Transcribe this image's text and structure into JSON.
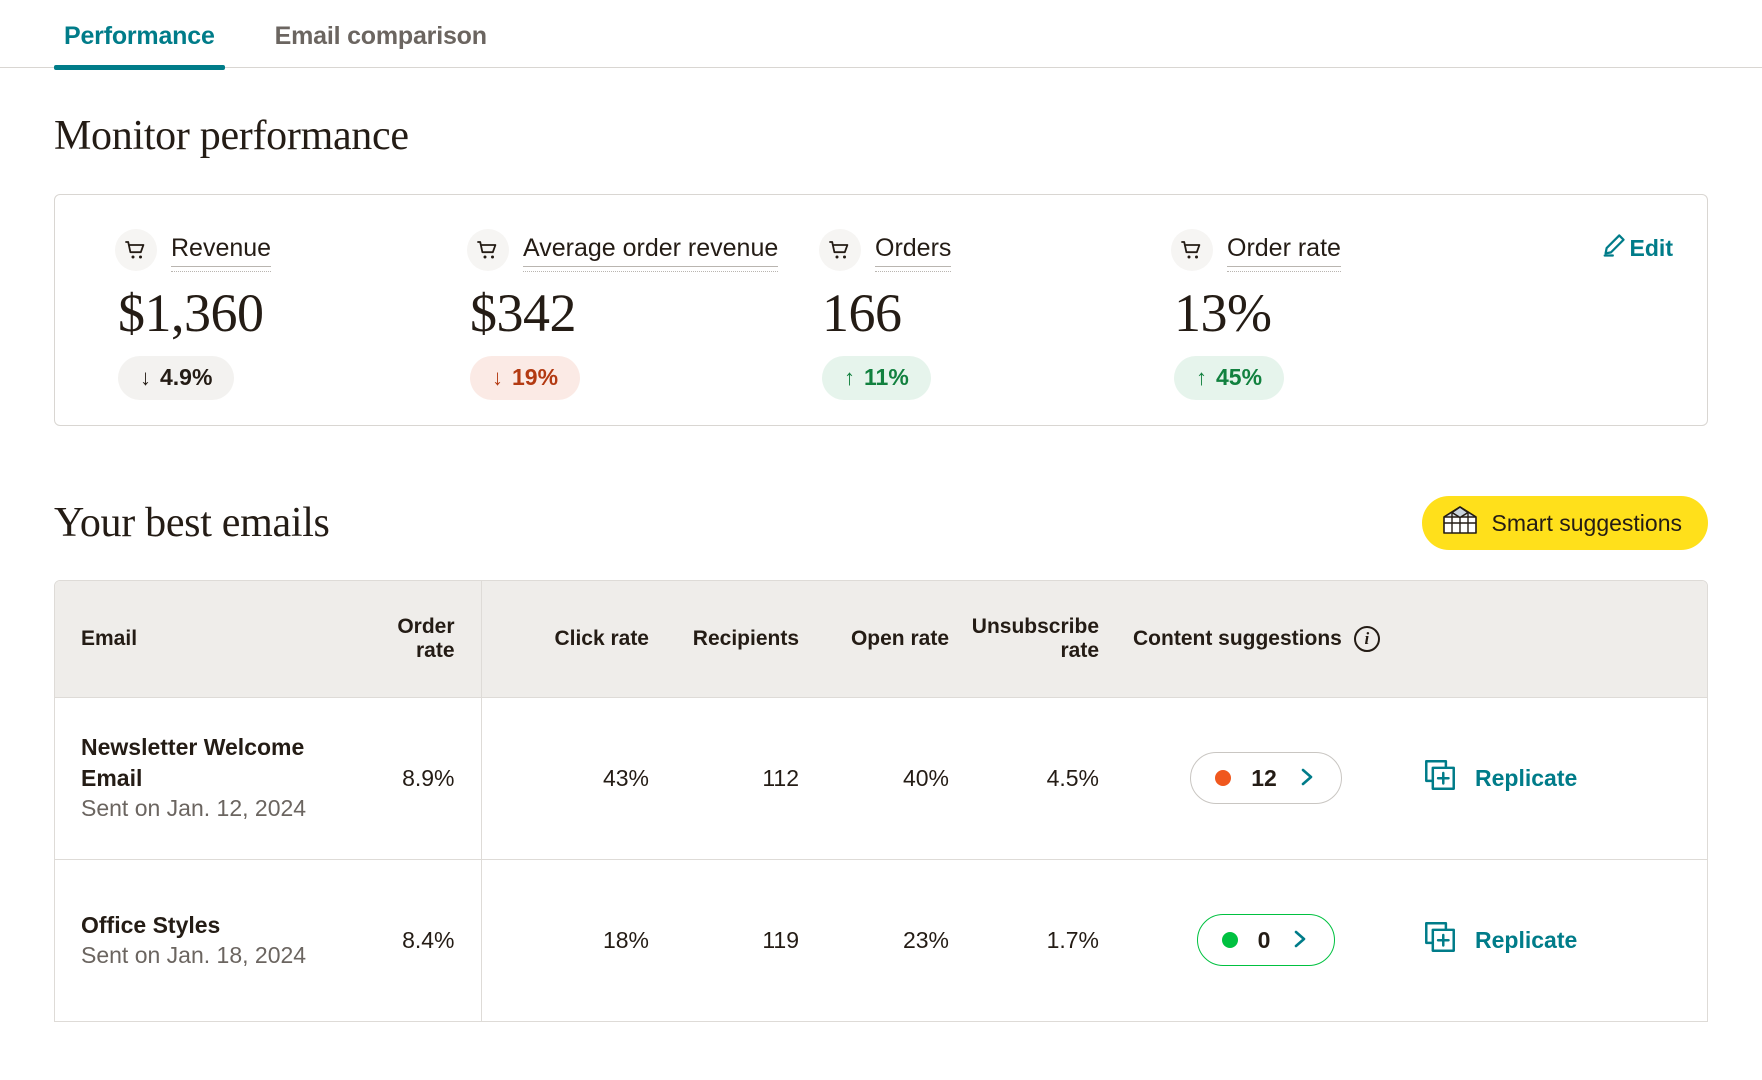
{
  "tabs": [
    {
      "label": "Performance",
      "active": true
    },
    {
      "label": "Email comparison",
      "active": false
    }
  ],
  "monitor": {
    "heading": "Monitor performance",
    "edit_label": "Edit",
    "metrics": [
      {
        "icon": "shopping-cart-icon",
        "label": "Revenue",
        "value": "$1,360",
        "delta": "4.9%",
        "direction": "down",
        "tone": "neutral"
      },
      {
        "icon": "shopping-cart-icon",
        "label": "Average order revenue",
        "value": "$342",
        "delta": "19%",
        "direction": "down",
        "tone": "down"
      },
      {
        "icon": "shopping-cart-icon",
        "label": "Orders",
        "value": "166",
        "delta": "11%",
        "direction": "up",
        "tone": "up"
      },
      {
        "icon": "shopping-cart-icon",
        "label": "Order rate",
        "value": "13%",
        "delta": "45%",
        "direction": "up",
        "tone": "up"
      }
    ]
  },
  "best_emails": {
    "heading": "Your best emails",
    "smart_button": {
      "label": "Smart suggestions",
      "icon": "greenhouse-icon",
      "bg": "#ffe01b"
    },
    "columns": {
      "email": "Email",
      "order_rate": "Order rate",
      "click_rate": "Click rate",
      "recipients": "Recipients",
      "open_rate": "Open rate",
      "unsubscribe_rate": "Unsubscribe rate",
      "content_suggestions": "Content suggestions",
      "info_glyph": "i"
    },
    "rows": [
      {
        "name": "Newsletter Welcome Email",
        "sent": "Sent on Jan. 12, 2024",
        "order_rate": "8.9%",
        "click_rate": "43%",
        "recipients": "112",
        "open_rate": "40%",
        "unsubscribe_rate": "4.5%",
        "suggestions_count": "12",
        "suggestions_tone": "orange",
        "suggestions_dot_color": "#f0581e",
        "replicate_label": "Replicate"
      },
      {
        "name": "Office Styles",
        "sent": "Sent on Jan. 18, 2024",
        "order_rate": "8.4%",
        "click_rate": "18%",
        "recipients": "119",
        "open_rate": "23%",
        "unsubscribe_rate": "1.7%",
        "suggestions_count": "0",
        "suggestions_tone": "green",
        "suggestions_dot_color": "#00c140",
        "replicate_label": "Replicate"
      }
    ]
  },
  "colors": {
    "accent_teal": "#007c89",
    "brand_yellow": "#ffe01b",
    "positive_green": "#12813f",
    "negative_red": "#b33a12",
    "orange_dot": "#f0581e"
  }
}
